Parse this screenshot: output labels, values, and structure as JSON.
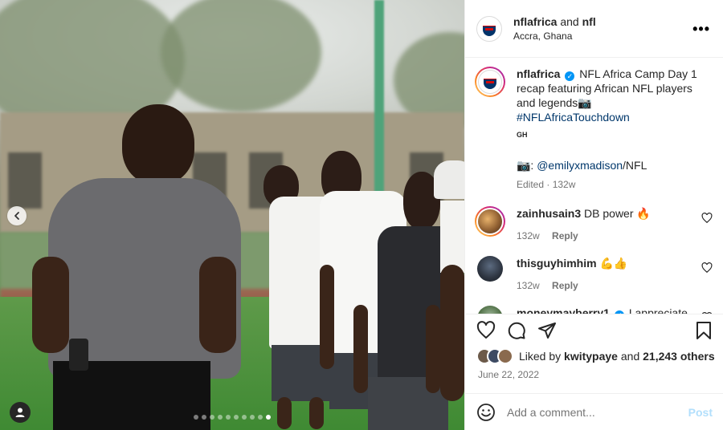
{
  "header": {
    "account": "nflafrica",
    "connector": "and",
    "collaborator": "nfl",
    "location": "Accra, Ghana",
    "more_icon": "more-horizontal-icon"
  },
  "caption": {
    "username": "nflafrica",
    "text": "NFL Africa Camp Day 1 recap featuring African NFL players and legends📷",
    "hashtag": "#NFLAfricaTouchdown",
    "badge": "GH",
    "credit_prefix": "📷:",
    "credit_mention": "@emilyxmadison",
    "credit_suffix": "/NFL",
    "edited": "Edited",
    "age": "132w"
  },
  "comments": [
    {
      "username": "zainhusain3",
      "text": "DB power 🔥",
      "age": "132w",
      "reply": "Reply"
    },
    {
      "username": "thisguyhimhim",
      "text": "💪👍",
      "age": "132w",
      "reply": "Reply"
    },
    {
      "username": "moneymayberry1",
      "text": "I appreciate",
      "verified": true
    }
  ],
  "likes": {
    "prefix": "Liked by",
    "user": "kwitypaye",
    "middle": "and",
    "count": "21,243 others"
  },
  "date": "June 22, 2022",
  "add_comment": {
    "placeholder": "Add a comment...",
    "post_label": "Post"
  },
  "carousel": {
    "total_slides": 10,
    "active_slide": 10
  },
  "colors": {
    "accent": "#0095f6",
    "post_disabled": "#b2dffc",
    "link": "#00376b"
  }
}
